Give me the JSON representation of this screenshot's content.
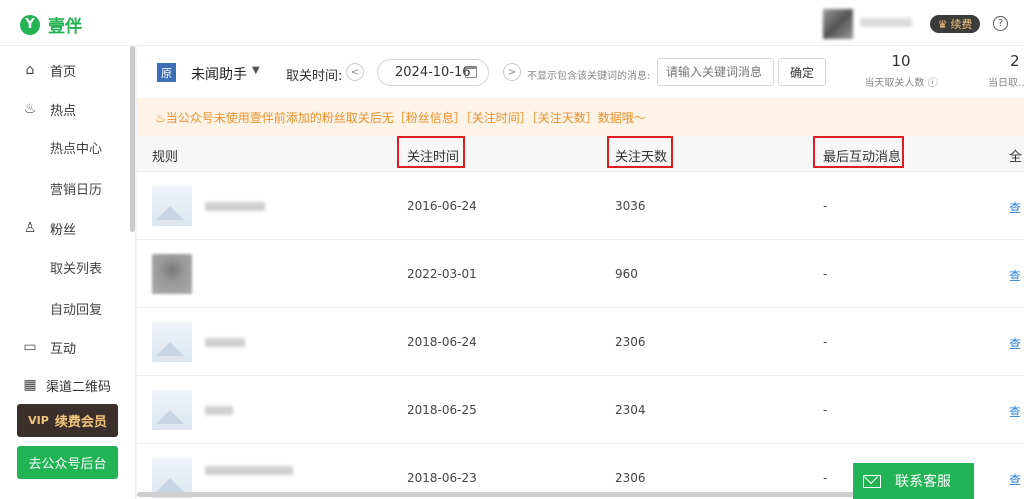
{
  "app": {
    "logo_glyph": "Y",
    "name": "壹伴",
    "brand_color": "#21b354"
  },
  "header": {
    "vip_label": "续费",
    "help_glyph": "?"
  },
  "sidebar": {
    "items": [
      {
        "label": "首页",
        "icon": "home-icon",
        "glyph": "⌂"
      },
      {
        "label": "热点",
        "icon": "flame-icon",
        "glyph": "♨"
      },
      {
        "label": "热点中心",
        "sub": true
      },
      {
        "label": "营销日历",
        "sub": true
      },
      {
        "label": "粉丝",
        "icon": "user-icon",
        "glyph": "♙"
      },
      {
        "label": "取关列表",
        "sub": true
      },
      {
        "label": "自动回复",
        "sub": true
      },
      {
        "label": "互动",
        "icon": "chat-icon",
        "glyph": "▭"
      },
      {
        "label": "渠道二维码",
        "icon": "qrcode-icon",
        "glyph": "▦"
      }
    ],
    "vip_button": "续费会员",
    "vip_badge": "VIP",
    "backend_button": "去公众号后台"
  },
  "filter": {
    "account_glyph": "原",
    "account_name": "未闻助手",
    "date_label": "取关时间:",
    "date_value": "2024-10-16",
    "prev_glyph": "<",
    "next_glyph": ">",
    "exclude_label": "不显示包含该关键词的消息:",
    "keyword_placeholder": "请输入关键词消息",
    "confirm_label": "确定"
  },
  "stats": [
    {
      "value": "10",
      "caption": "当天取关人数 ⓘ"
    },
    {
      "value": "2",
      "caption": "当日取…均关…"
    }
  ],
  "notice": "♨当公众号未使用壹伴前添加的粉丝取关后无［粉丝信息］［关注时间］［关注天数］数据哦～",
  "table": {
    "headers": [
      "规则",
      "关注时间",
      "关注天数",
      "最后互动消息",
      "全"
    ],
    "rows": [
      {
        "time": "2016-06-24",
        "days": "3036",
        "msg": "-",
        "view": "查"
      },
      {
        "time": "2022-03-01",
        "days": "960",
        "msg": "-",
        "view": "查"
      },
      {
        "time": "2018-06-24",
        "days": "2306",
        "msg": "-",
        "view": "查"
      },
      {
        "time": "2018-06-25",
        "days": "2304",
        "msg": "-",
        "view": "查"
      },
      {
        "time": "2018-06-23",
        "days": "2306",
        "msg": "-",
        "view": "查"
      }
    ]
  },
  "service_button": "联系客服"
}
